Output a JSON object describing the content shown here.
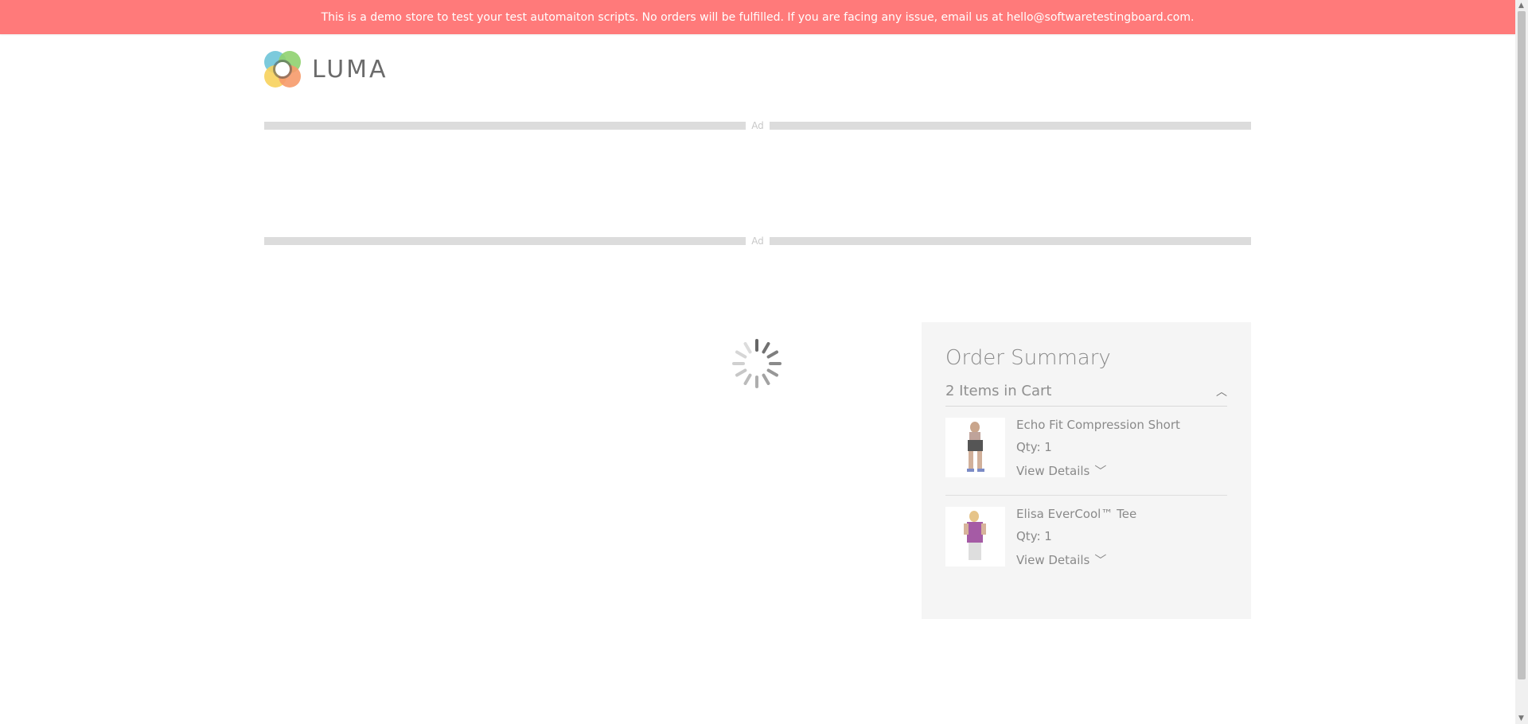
{
  "banner": {
    "text": "This is a demo store to test your test automaiton scripts. No orders will be fulfilled. If you are facing any issue, email us at hello@softwaretestingboard.com."
  },
  "logo": {
    "text": "LUMA"
  },
  "ads": {
    "top_label": "Ad",
    "bottom_label": "Ad"
  },
  "colors": {
    "banner_bg": "#ff7a7a",
    "summary_bg": "#f5f5f5"
  },
  "order_summary": {
    "title": "Order Summary",
    "items_in_cart_label": "2 Items in Cart",
    "items": [
      {
        "name": "Echo Fit Compression Short",
        "qty": "Qty: 1",
        "view_details": "View Details",
        "image_icon": "shorts-product-thumbnail"
      },
      {
        "name": "Elisa EverCool™ Tee",
        "qty": "Qty: 1",
        "view_details": "View Details",
        "image_icon": "tee-product-thumbnail"
      }
    ]
  }
}
